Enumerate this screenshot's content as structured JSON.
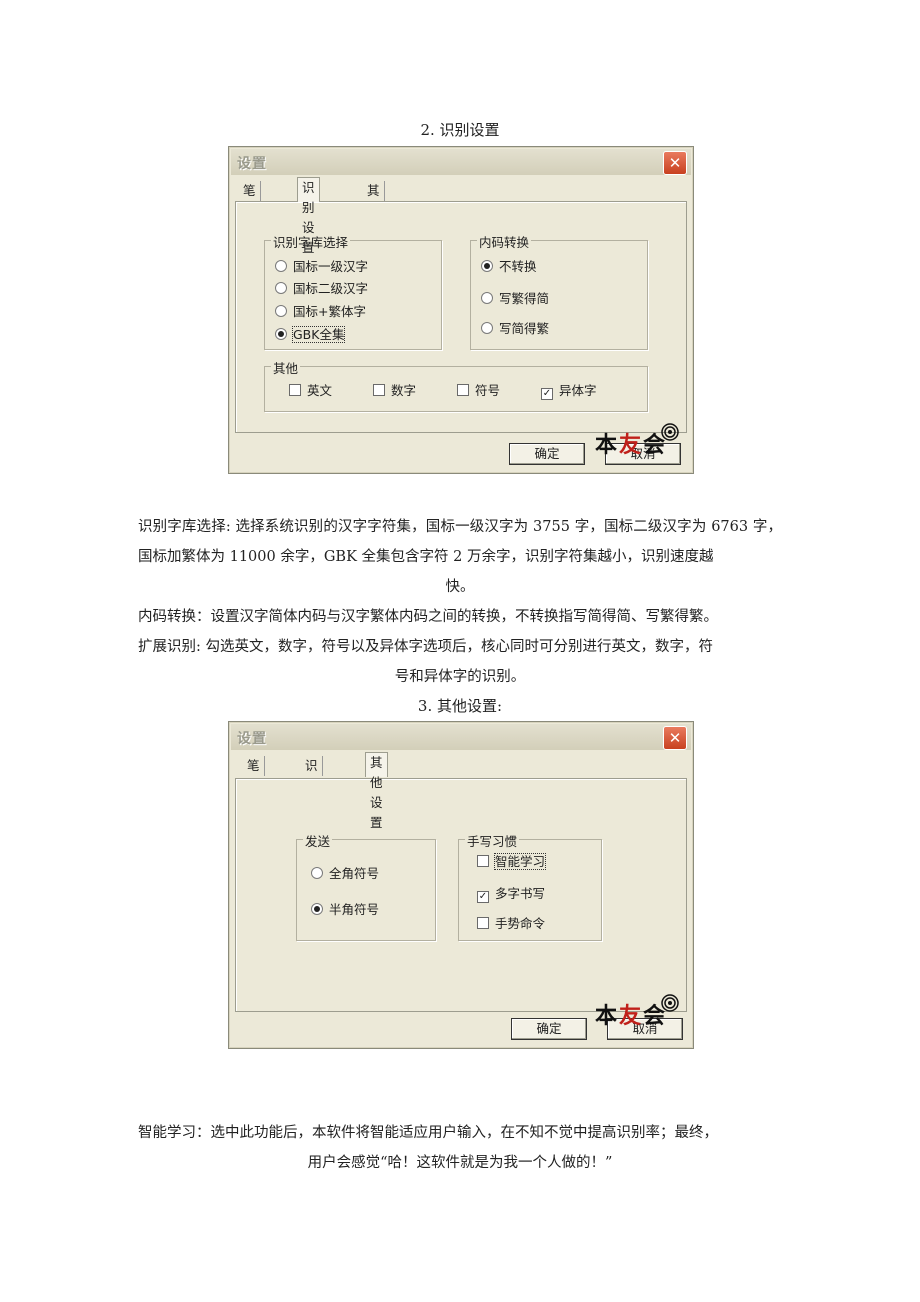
{
  "section2": {
    "caption": "2. 识别设置"
  },
  "dialog1": {
    "title": "设置",
    "close_glyph": "✕",
    "tabs": [
      "笔设置",
      "识别设置",
      "其他设置"
    ],
    "active_tab": "识别设置",
    "lib_group": {
      "label": "识别字库选择",
      "options": [
        "国标一级汉字",
        "国标二级汉字",
        "国标+繁体字",
        "GBK全集"
      ],
      "selected": "GBK全集"
    },
    "code_group": {
      "label": "内码转换",
      "options": [
        "不转换",
        "写繁得简",
        "写简得繁"
      ],
      "selected": "不转换"
    },
    "other_group": {
      "label": "其他",
      "checkboxes": [
        {
          "label": "英文",
          "checked": false
        },
        {
          "label": "数字",
          "checked": false
        },
        {
          "label": "符号",
          "checked": false
        },
        {
          "label": "异体字",
          "checked": true
        }
      ]
    },
    "ok_label": "确定",
    "cancel_label": "取消"
  },
  "watermark": {
    "chars": [
      "本",
      "友",
      "会"
    ]
  },
  "paragraphs1": {
    "p1_main": "识别字库选择: 选择系统识别的汉字字符集，国标一级汉字为 3755 字，国标二级汉字为 6763 字，国标加繁体为 11000 余字，GBK 全集包含字符 2 万余字，识别字符集越小，识别速度越",
    "p1_end": "快。",
    "p2": "内码转换：设置汉字简体内码与汉字繁体内码之间的转换，不转换指写简得简、写繁得繁。",
    "p3_main": "扩展识别: 勾选英文，数字，符号以及异体字选项后，核心同时可分别进行英文，数字，符",
    "p3_end": "号和异体字的识别。"
  },
  "section3": {
    "caption": "3. 其他设置:"
  },
  "dialog2": {
    "title": "设置",
    "close_glyph": "✕",
    "tabs": [
      "笔设置",
      "识别设置",
      "其他设置"
    ],
    "active_tab": "其他设置",
    "send_group": {
      "label": "发送",
      "options": [
        "全角符号",
        "半角符号"
      ],
      "selected": "半角符号"
    },
    "habit_group": {
      "label": "手写习惯",
      "checkboxes": [
        {
          "label": "智能学习",
          "checked": false
        },
        {
          "label": "多字书写",
          "checked": true
        },
        {
          "label": "手势命令",
          "checked": false
        }
      ]
    },
    "ok_label": "确定",
    "cancel_label": "取消"
  },
  "paragraphs2": {
    "p1_main": "智能学习：选中此功能后，本软件将智能适应用户输入，在不知不觉中提高识别率；最终，",
    "p1_end": "用户会感觉“哈！这软件就是为我一个人做的！”"
  },
  "colors": {
    "dialog_bg": "#ece9d8",
    "close_red": "#c8401f",
    "watermark_red": "#c0201a"
  },
  "icons": {
    "close": "close-icon",
    "signal": "signal-icon"
  }
}
